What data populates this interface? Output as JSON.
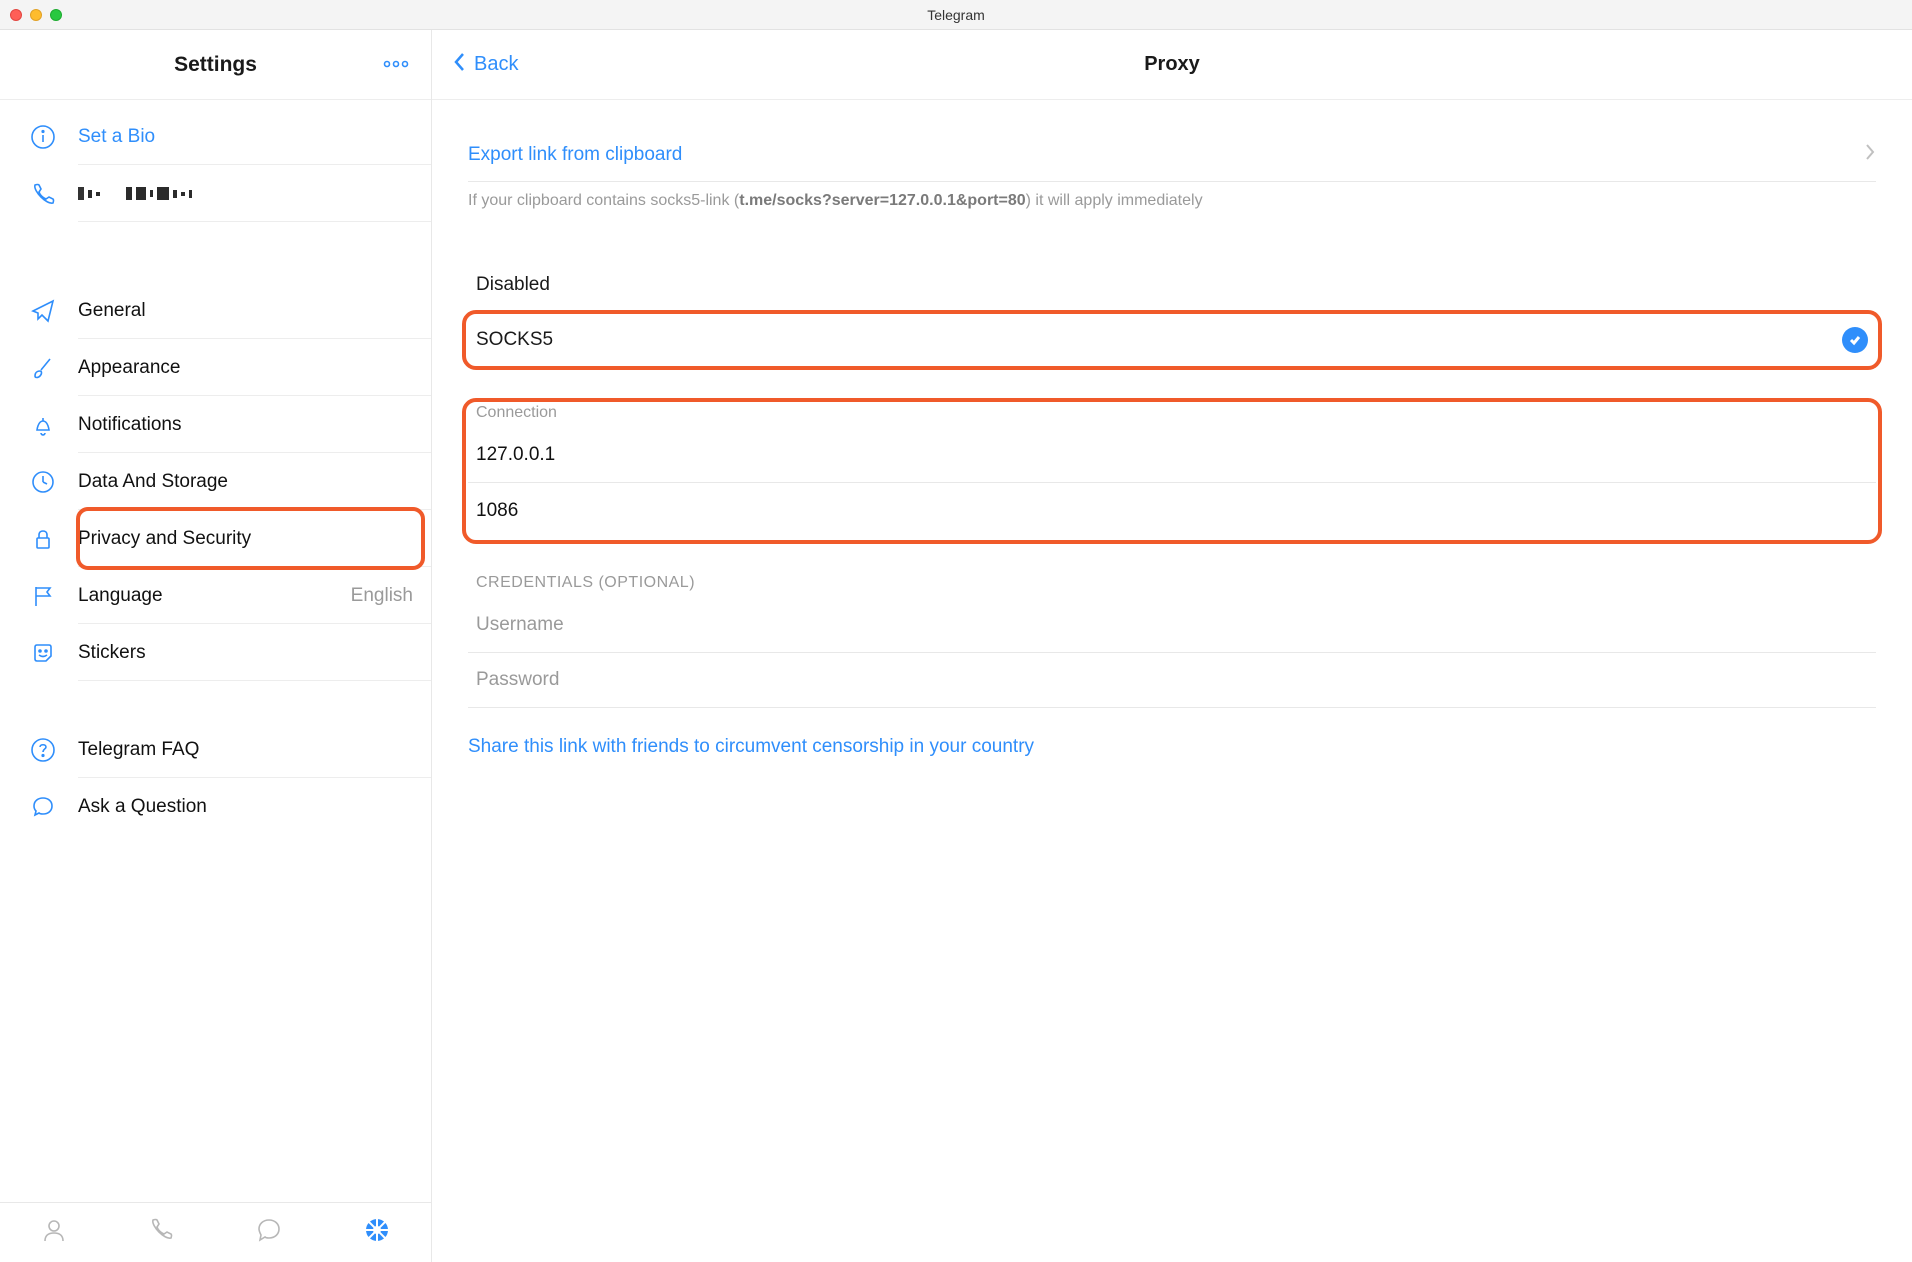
{
  "window": {
    "title": "Telegram"
  },
  "sidebar": {
    "title": "Settings",
    "more_label": "○○○",
    "bio": {
      "label": "Set a Bio"
    },
    "items": {
      "general": "General",
      "appearance": "Appearance",
      "notifications": "Notifications",
      "data_storage": "Data And Storage",
      "privacy": "Privacy and Security",
      "language": "Language",
      "language_value": "English",
      "stickers": "Stickers",
      "faq": "Telegram FAQ",
      "ask": "Ask a Question"
    }
  },
  "detail": {
    "back_label": "Back",
    "title": "Proxy",
    "export_link": "Export link from clipboard",
    "export_hint_prefix": "If your clipboard contains socks5-link (",
    "export_hint_bold": "t.me/socks?server=127.0.0.1&port=80",
    "export_hint_suffix": ") it will apply immediately",
    "type_group": {
      "disabled": "Disabled",
      "socks5": "SOCKS5"
    },
    "connection": {
      "header": "Connection",
      "host": "127.0.0.1",
      "port": "1086"
    },
    "credentials": {
      "header": "CREDENTIALS (OPTIONAL)",
      "username_placeholder": "Username",
      "password_placeholder": "Password"
    },
    "share_link": "Share this link with friends to circumvent censorship in your country"
  }
}
